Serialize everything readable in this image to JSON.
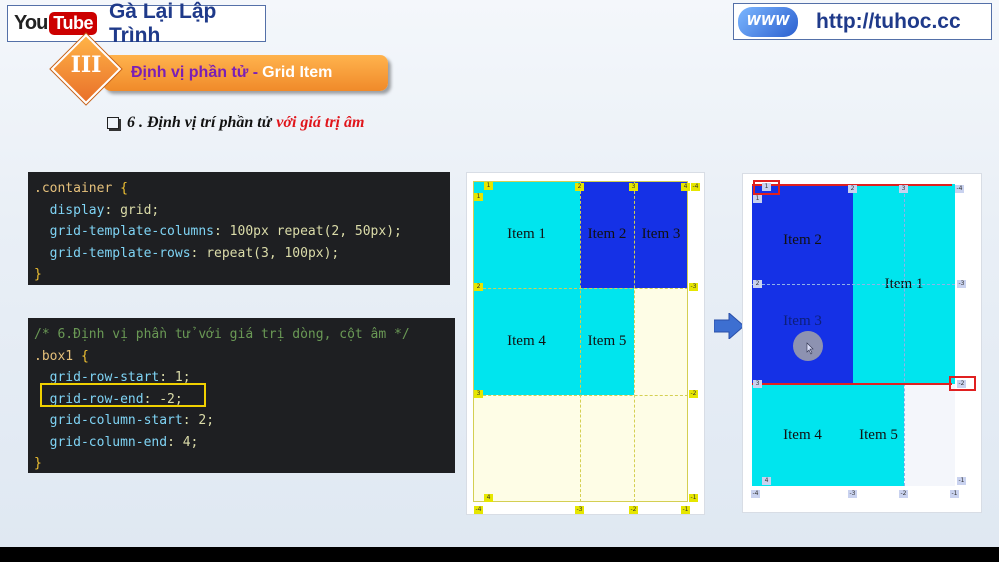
{
  "header": {
    "yt_you": "You",
    "yt_tube": "Tube",
    "channel": "Gà Lại Lập Trình",
    "site_badge": "WWW",
    "site_url": "http://tuhoc.cc"
  },
  "section": {
    "number": "III",
    "title_a": "Định vị phần tử - ",
    "title_b": "Grid Item"
  },
  "subheading": {
    "text": "6 . Định vị trí phần tử",
    "highlight": "với giá trị âm"
  },
  "code1": {
    "line1_sel": ".container",
    "line1_brace": " {",
    "line2_prop": "  display",
    "line2_val": ": grid;",
    "line3_prop": "  grid-template-columns",
    "line3_val": ": 100px repeat(2, 50px);",
    "line4_prop": "  grid-template-rows",
    "line4_val": ": repeat(3, 100px);",
    "line5": "}"
  },
  "code2": {
    "comment": "/* 6.Định vị phần tử với giá trị dòng, cột âm */",
    "sel": ".box1",
    "brace_open": " {",
    "l1_prop": "  grid-row-start",
    "l1_val": ": 1;",
    "l2_prop": "  grid-row-end",
    "l2_val": ": -2;",
    "l3_prop": "  grid-column-start",
    "l3_val": ": 2;",
    "l4_prop": "  grid-column-end",
    "l4_val": ": 4;",
    "brace_close": "}"
  },
  "grid_before": {
    "item1": "Item 1",
    "item2": "Item 2",
    "item3": "Item 3",
    "item4": "Item 4",
    "item5": "Item 5",
    "tags": [
      "1",
      "2",
      "3",
      "4",
      "-4",
      "1",
      "-3",
      "2",
      "-2",
      "3",
      "-1",
      "4",
      "-4",
      "-3",
      "-2",
      "-1"
    ]
  },
  "grid_after": {
    "item2": "Item 2",
    "item1": "Item 1",
    "item3": "Item 3",
    "item4": "Item 4",
    "item5": "Item 5",
    "tags": [
      "1",
      "1",
      "2",
      "3",
      "-4",
      "2",
      "-3",
      "3",
      "-2",
      "4",
      "-1",
      "-4",
      "-3",
      "-2",
      "-1"
    ]
  },
  "colors": {
    "cyan": "#00e5ee",
    "blue": "#1531e6",
    "cream": "#fefde6",
    "highlight": "#f0d000",
    "accent_red": "#e02020"
  }
}
